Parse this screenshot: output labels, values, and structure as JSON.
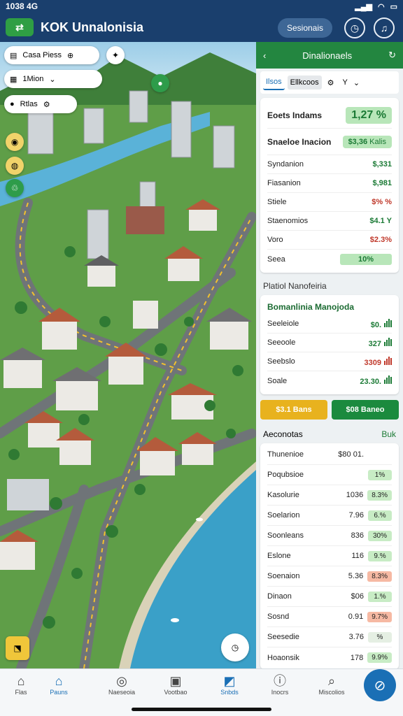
{
  "status": {
    "time": "1038 4G",
    "battery": "▮"
  },
  "app": {
    "title": "KOK Unnalonisia",
    "session_label": "Sesionais"
  },
  "map": {
    "search_chip": "Casa Piess",
    "filter_chip": "1Mion",
    "layer_chip": "Rtlas"
  },
  "panel": {
    "title": "Dinalionaels",
    "tabs": [
      "Ilsos",
      "Ellkcoos",
      "Y"
    ],
    "card1": {
      "headline_label": "Eoets Indams",
      "headline_value": "1,27 %",
      "sub_label": "Snaeloe Inacion",
      "sub_value": "$3,36",
      "sub_suffix": "Kalis",
      "rows": [
        {
          "label": "Syndanion",
          "value": "$,331",
          "color": "#1b7a35"
        },
        {
          "label": "Fiasanion",
          "value": "$,981",
          "color": "#1b7a35"
        },
        {
          "label": "Stiele",
          "value": "$% %",
          "color": "#c0392b"
        },
        {
          "label": "Staenomios",
          "value": "$4.1 Y",
          "color": "#1b7a35"
        },
        {
          "label": "Voro",
          "value": "$2.3%",
          "color": "#c0392b"
        },
        {
          "label": "Seea",
          "value": "10%",
          "color": "#1b7a35"
        }
      ]
    },
    "section2_title": "Platiol Nanofeiria",
    "card2": {
      "title": "Bomanlinia Manojoda",
      "rows": [
        {
          "label": "Seeleiole",
          "value": "$0.",
          "color": "#1b7a35"
        },
        {
          "label": "Seeoole",
          "value": "327",
          "color": "#1b7a35"
        },
        {
          "label": "Seebslo",
          "value": "3309",
          "color": "#c0392b"
        },
        {
          "label": "Soale",
          "value": "23.30.",
          "color": "#1b7a35"
        }
      ],
      "action1": "$3.1 Bans",
      "action2": "$08 Baneo"
    },
    "section3_title": "Aeconotas",
    "section3_link": "Buk",
    "list": [
      {
        "label": "Thunenioe",
        "value": "$80 01.",
        "tag": "",
        "tagcolor": "#ffffff"
      },
      {
        "label": "Poqubsioe",
        "value": "",
        "tag": "1%",
        "tagcolor": "#c8ecc5"
      },
      {
        "label": "Kasolurie",
        "value": "1036",
        "tag": "8.3%",
        "tagcolor": "#c8ecc5"
      },
      {
        "label": "Soelarion",
        "value": "7.96",
        "tag": "6.%",
        "tagcolor": "#c8ecc5"
      },
      {
        "label": "Soonleans",
        "value": "836",
        "tag": "30%",
        "tagcolor": "#c8ecc5"
      },
      {
        "label": "Eslone",
        "value": "116",
        "tag": "9.%",
        "tagcolor": "#c8ecc5"
      },
      {
        "label": "Soenaion",
        "value": "5.36",
        "tag": "8.3%",
        "tagcolor": "#f6b9a3"
      },
      {
        "label": "Dinaon",
        "value": "$06",
        "tag": "1.%",
        "tagcolor": "#c8ecc5"
      },
      {
        "label": "Sosnd",
        "value": "0.91",
        "tag": "9.7%",
        "tagcolor": "#f6b9a3"
      },
      {
        "label": "Seesedie",
        "value": "3.76",
        "tag": "%",
        "tagcolor": "#e5efe3"
      },
      {
        "label": "Hoaonsik",
        "value": "178",
        "tag": "9.9%",
        "tagcolor": "#c8ecc5"
      }
    ]
  },
  "nav": [
    {
      "label": "Flas",
      "icon": "⌂"
    },
    {
      "label": "Pauns",
      "icon": "⌂"
    },
    {
      "label": "Naeseoia",
      "icon": "◎"
    },
    {
      "label": "Vootbao",
      "icon": "▣"
    },
    {
      "label": "Snbds",
      "icon": "◩"
    },
    {
      "label": "Inocrs",
      "icon": "ⓘ"
    },
    {
      "label": "Miscolios",
      "icon": "⌕"
    }
  ],
  "colors": {
    "brand": "#1a3f6d",
    "accent": "#238640",
    "link": "#1a6fb5"
  }
}
